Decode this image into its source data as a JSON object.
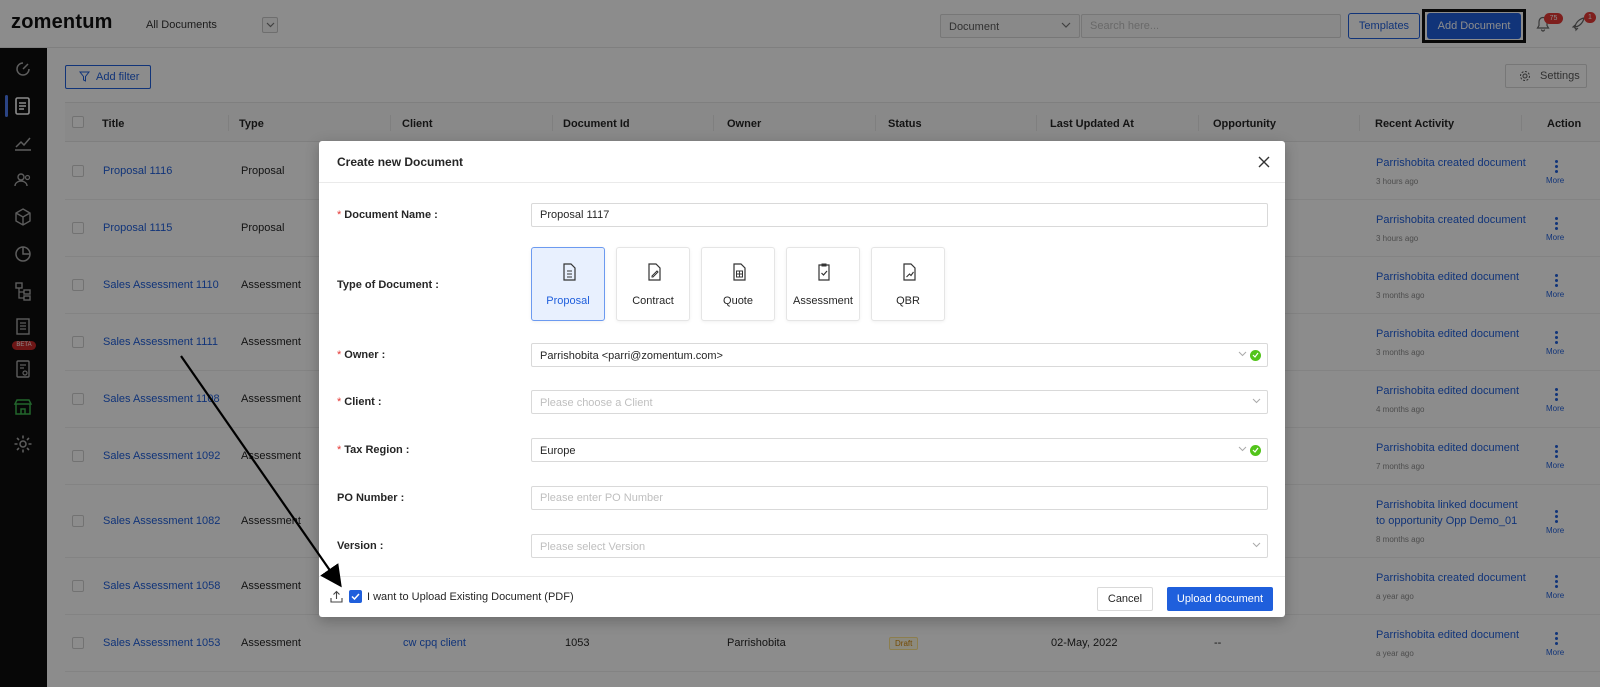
{
  "header": {
    "logo": "zomentum",
    "view_select": "All Documents",
    "search_type": "Document",
    "search_placeholder": "Search here...",
    "templates_label": "Templates",
    "add_document_label": "Add Document",
    "notifications_count": "75",
    "updates_count": "1"
  },
  "sidebar": {
    "items": [
      "dashboard-icon",
      "documents-icon",
      "analytics-icon",
      "clients-icon",
      "products-icon",
      "reports-icon",
      "workflow-icon",
      "marketplace-beta-icon",
      "billing-icon",
      "store-icon",
      "settings-icon"
    ],
    "beta_label": "BETA"
  },
  "toolbar": {
    "add_filter_label": "Add filter",
    "settings_label": "Settings"
  },
  "table": {
    "columns": [
      "Title",
      "Type",
      "Client",
      "Document Id",
      "Owner",
      "Status",
      "Last Updated At",
      "Opportunity",
      "Recent Activity",
      "Action"
    ],
    "rows": [
      {
        "title": "Proposal 1116",
        "type": "Proposal",
        "activity": "Parrishobita created document",
        "time": "3 hours ago",
        "more": "More"
      },
      {
        "title": "Proposal 1115",
        "type": "Proposal",
        "activity": "Parrishobita created document",
        "time": "3 hours ago",
        "more": "More"
      },
      {
        "title": "Sales Assessment 1110",
        "type": "Assessment",
        "activity": "Parrishobita edited document",
        "time": "3 months ago",
        "more": "More"
      },
      {
        "title": "Sales Assessment 1111",
        "type": "Assessment",
        "activity": "Parrishobita edited document",
        "time": "3 months ago",
        "more": "More"
      },
      {
        "title": "Sales Assessment 1108",
        "type": "Assessment",
        "activity": "Parrishobita edited document",
        "time": "4 months ago",
        "more": "More"
      },
      {
        "title": "Sales Assessment 1092",
        "type": "Assessment",
        "activity": "Parrishobita edited document",
        "time": "7 months ago",
        "more": "More"
      },
      {
        "title": "Sales Assessment 1082",
        "type": "Assessment",
        "activity": "Parrishobita linked document to opportunity Opp Demo_01",
        "time": "8 months ago",
        "more": "More"
      },
      {
        "title": "Sales Assessment 1058",
        "type": "Assessment",
        "activity": "Parrishobita created document",
        "time": "a year ago",
        "more": "More"
      },
      {
        "title": "Sales Assessment 1053",
        "type": "Assessment",
        "client": "cw cpq client",
        "doc_id": "1053",
        "owner": "Parrishobita",
        "status": "Draft",
        "updated": "02-May, 2022",
        "opportunity": "--",
        "activity": "Parrishobita edited document",
        "time": "a year ago",
        "more": "More"
      }
    ]
  },
  "modal": {
    "title": "Create new Document",
    "document_name_label": "Document Name :",
    "document_name_value": "Proposal 1117",
    "type_label": "Type of Document :",
    "types": [
      "Proposal",
      "Contract",
      "Quote",
      "Assessment",
      "QBR"
    ],
    "selected_type": "Proposal",
    "owner_label": "Owner :",
    "owner_value": "Parrishobita <parri@zomentum.com>",
    "client_label": "Client :",
    "client_placeholder": "Please choose a Client",
    "tax_label": "Tax Region :",
    "tax_value": "Europe",
    "po_label": "PO Number :",
    "po_placeholder": "Please enter PO Number",
    "version_label": "Version :",
    "version_placeholder": "Please select Version",
    "upload_checkbox_label": "I want to Upload Existing Document (PDF)",
    "upload_checked": true,
    "cancel_label": "Cancel",
    "upload_label": "Upload document"
  },
  "colors": {
    "accent": "#1f5fdc",
    "sidebar": "#0d0d0d",
    "required": "#e53935",
    "ok": "#52c41a"
  }
}
